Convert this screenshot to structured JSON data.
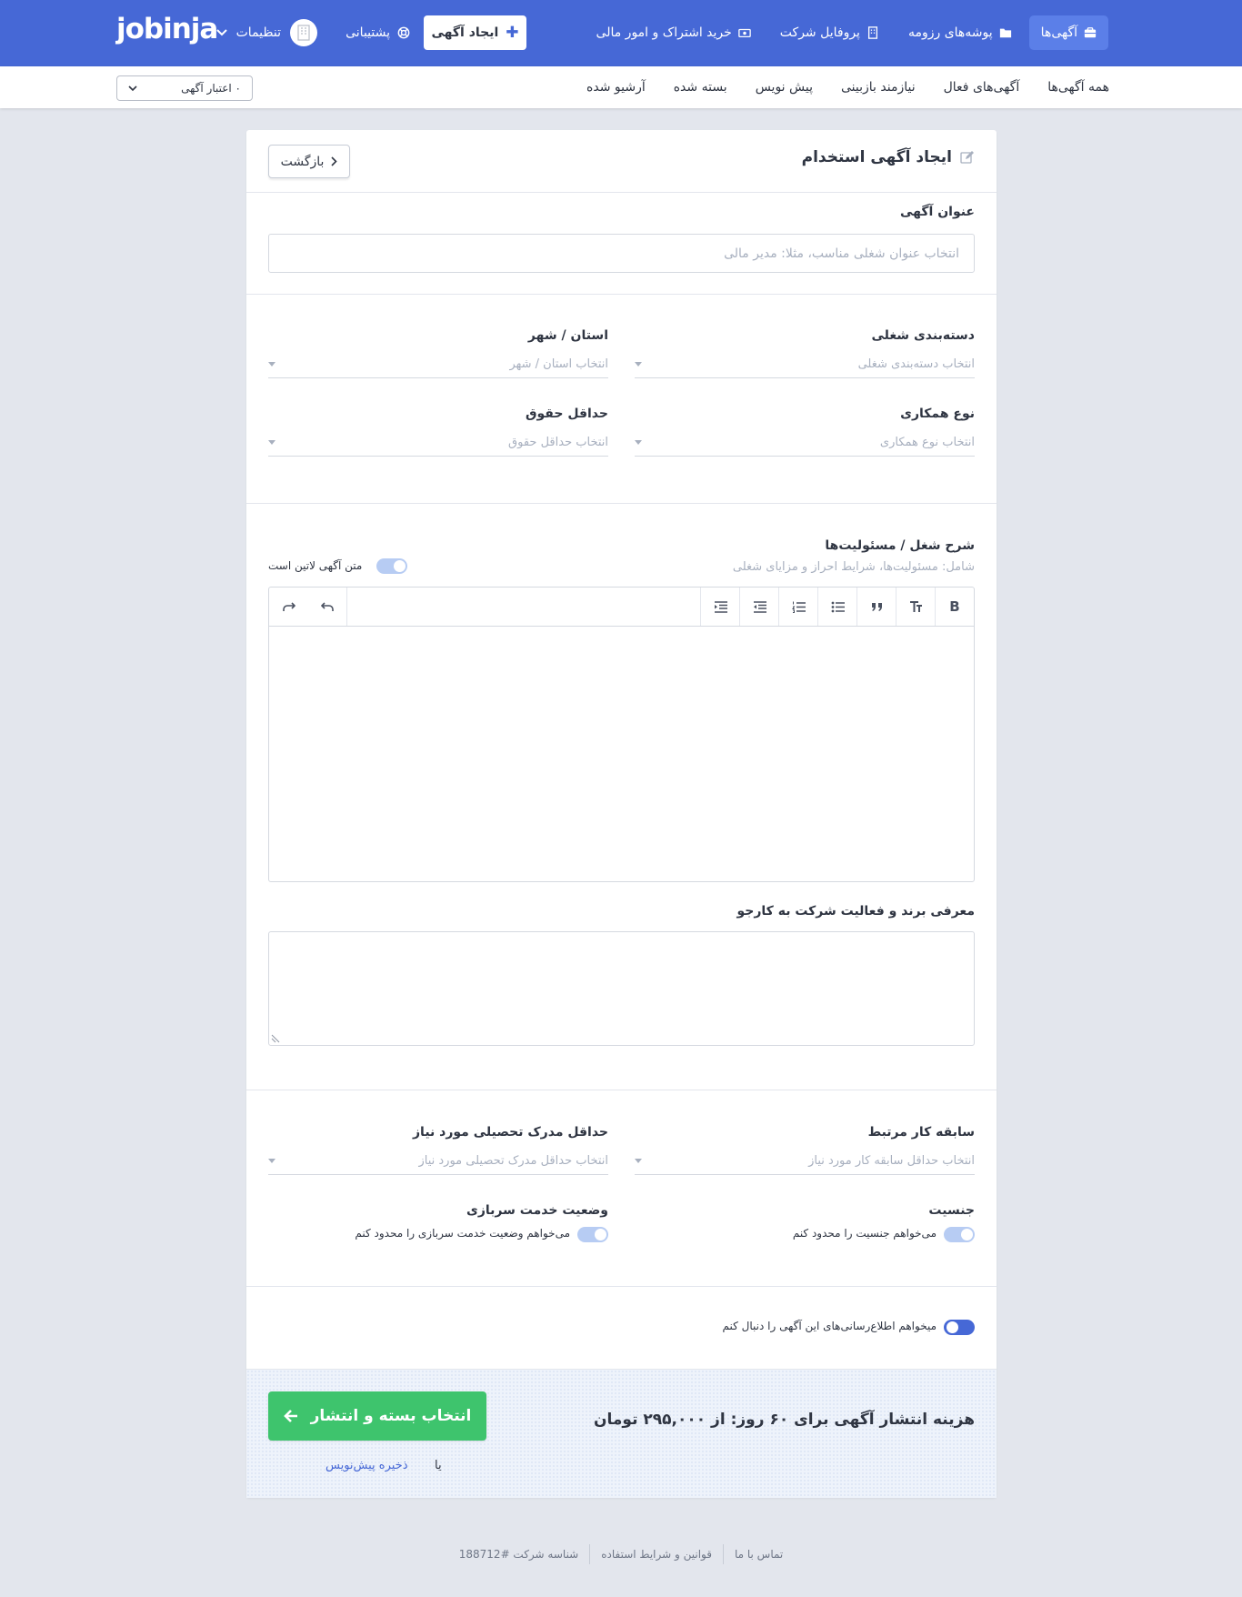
{
  "brand": {
    "logo": "jobinja"
  },
  "topnav": {
    "items": [
      {
        "label": "آگهی‌ها",
        "icon": "briefcase-icon",
        "active": true
      },
      {
        "label": "پوشه‌های رزومه",
        "icon": "folder-icon"
      },
      {
        "label": "پروفایل شرکت",
        "icon": "building-icon"
      },
      {
        "label": "خرید اشتراک و امور مالی",
        "icon": "money-icon"
      }
    ],
    "create_button": "ایجاد آگهی",
    "support": "پشتیبانی",
    "settings": "تنظیمات"
  },
  "subnav": {
    "tabs": [
      "همه آگهی‌ها",
      "آگهی‌های فعال",
      "نیازمند بازبینی",
      "پیش نویس",
      "بسته شده",
      "آرشیو شده"
    ],
    "credit_select": "۰ اعتبار آگهی"
  },
  "form": {
    "heading": "ایجاد آگهی استخدام",
    "back_button": "بازگشت",
    "job_title": {
      "label": "عنوان آگهی",
      "placeholder": "انتخاب عنوان شغلی مناسب، مثلا: مدیر مالی"
    },
    "category": {
      "label": "دسته‌بندی شغلی",
      "placeholder": "انتخاب دسته‌بندی شغلی"
    },
    "location": {
      "label": "استان / شهر",
      "placeholder": "انتخاب استان / شهر"
    },
    "contract_type": {
      "label": "نوع همکاری",
      "placeholder": "انتخاب نوع همکاری"
    },
    "min_salary": {
      "label": "حداقل حقوق",
      "placeholder": "انتخاب حداقل حقوق"
    },
    "description": {
      "label": "شرح شغل / مسئولیت‌ها",
      "hint": "شامل: مسئولیت‌ها، شرایط احراز و مزایای شغلی",
      "latin_toggle": "متن آگهی لاتین است"
    },
    "company_intro": {
      "label": "معرفی برند و فعالیت شرکت به کارجو"
    },
    "experience": {
      "label": "سابقه کار مرتبط",
      "placeholder": "انتخاب حداقل سابقه کار مورد نیاز"
    },
    "education": {
      "label": "حداقل مدرک تحصیلی مورد نیاز",
      "placeholder": "انتخاب حداقل مدرک تحصیلی مورد نیاز"
    },
    "gender": {
      "label": "جنسیت",
      "toggle": "می‌خواهم جنسیت را محدود کنم"
    },
    "military": {
      "label": "وضعیت خدمت سربازی",
      "toggle": "می‌خواهم وضعیت خدمت سربازی را محدود کنم"
    },
    "notify_toggle": "میخواهم اطلاع‌رسانی‌های این آگهی را دنبال کنم"
  },
  "editor_toolbar": [
    {
      "name": "bold-button",
      "glyph": "B"
    },
    {
      "name": "heading-button",
      "glyph": "T"
    },
    {
      "name": "quote-button",
      "glyph": "❞"
    },
    {
      "name": "bullet-list-button",
      "glyph": "≡"
    },
    {
      "name": "numbered-list-button",
      "glyph": "≡"
    },
    {
      "name": "outdent-button",
      "glyph": "⇤"
    },
    {
      "name": "indent-button",
      "glyph": "⇥"
    }
  ],
  "publish": {
    "price_text": "هزینه انتشار آگهی برای ۶۰ روز: از ۲۹۵,۰۰۰ تومان",
    "button": "انتخاب بسته و انتشار",
    "or": "یا",
    "draft_link": "ذخیره پیش‌نویس"
  },
  "footer": {
    "contact": "تماس با ما",
    "terms": "قوانین و شرایط استفاده",
    "company_id": "شناسه شرکت #188712"
  },
  "colors": {
    "brand": "#4668d6",
    "success": "#3ec46d",
    "page_bg": "#e3e6ed"
  }
}
